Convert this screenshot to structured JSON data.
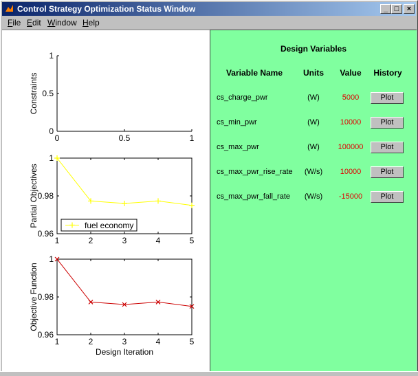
{
  "window": {
    "title": "Control Strategy Optimization Status Window",
    "minimize_glyph": "_",
    "maximize_glyph": "□",
    "close_glyph": "×"
  },
  "menu": [
    {
      "label": "File",
      "accel": "F",
      "rest": "ile"
    },
    {
      "label": "Edit",
      "accel": "E",
      "rest": "dit"
    },
    {
      "label": "Window",
      "accel": "W",
      "rest": "indow"
    },
    {
      "label": "Help",
      "accel": "H",
      "rest": "elp"
    }
  ],
  "design_variables": {
    "title": "Design Variables",
    "headers": {
      "name": "Variable Name",
      "units": "Units",
      "value": "Value",
      "history": "History"
    },
    "rows": [
      {
        "name": "cs_charge_pwr",
        "units": "(W)",
        "value": "5000",
        "button": "Plot"
      },
      {
        "name": "cs_min_pwr",
        "units": "(W)",
        "value": "10000",
        "button": "Plot"
      },
      {
        "name": "cs_max_pwr",
        "units": "(W)",
        "value": "100000",
        "button": "Plot"
      },
      {
        "name": "cs_max_pwr_rise_rate",
        "units": "(W/s)",
        "value": "10000",
        "button": "Plot"
      },
      {
        "name": "cs_max_pwr_fall_rate",
        "units": "(W/s)",
        "value": "-15000",
        "button": "Plot"
      }
    ]
  },
  "chart_data": [
    {
      "type": "line",
      "ylabel": "Constraints",
      "xlim": [
        0,
        1
      ],
      "ylim": [
        0,
        1
      ],
      "xticks": [
        "0",
        "0.5",
        "1"
      ],
      "yticks": [
        "0",
        "0.5",
        "1"
      ],
      "series": []
    },
    {
      "type": "line",
      "ylabel": "Partial Objectives",
      "xlim": [
        1,
        5
      ],
      "ylim": [
        0.96,
        1
      ],
      "xticks": [
        "1",
        "2",
        "3",
        "4",
        "5"
      ],
      "yticks": [
        "0.96",
        "0.98",
        "1"
      ],
      "color": "#ffff00",
      "legend": "bottom-left",
      "x": [
        1,
        2,
        3,
        4,
        5
      ],
      "series": [
        {
          "name": "fuel economy",
          "values": [
            1.0,
            0.9773,
            0.976,
            0.9773,
            0.975
          ]
        }
      ]
    },
    {
      "type": "line",
      "ylabel": "Objective Function",
      "xlabel": "Design Iteration",
      "xlim": [
        1,
        5
      ],
      "ylim": [
        0.96,
        1
      ],
      "xticks": [
        "1",
        "2",
        "3",
        "4",
        "5"
      ],
      "yticks": [
        "0.96",
        "0.98",
        "1"
      ],
      "color": "#cc0000",
      "x": [
        1,
        2,
        3,
        4,
        5
      ],
      "series": [
        {
          "values": [
            1.0,
            0.9773,
            0.976,
            0.9773,
            0.975
          ]
        }
      ]
    }
  ]
}
